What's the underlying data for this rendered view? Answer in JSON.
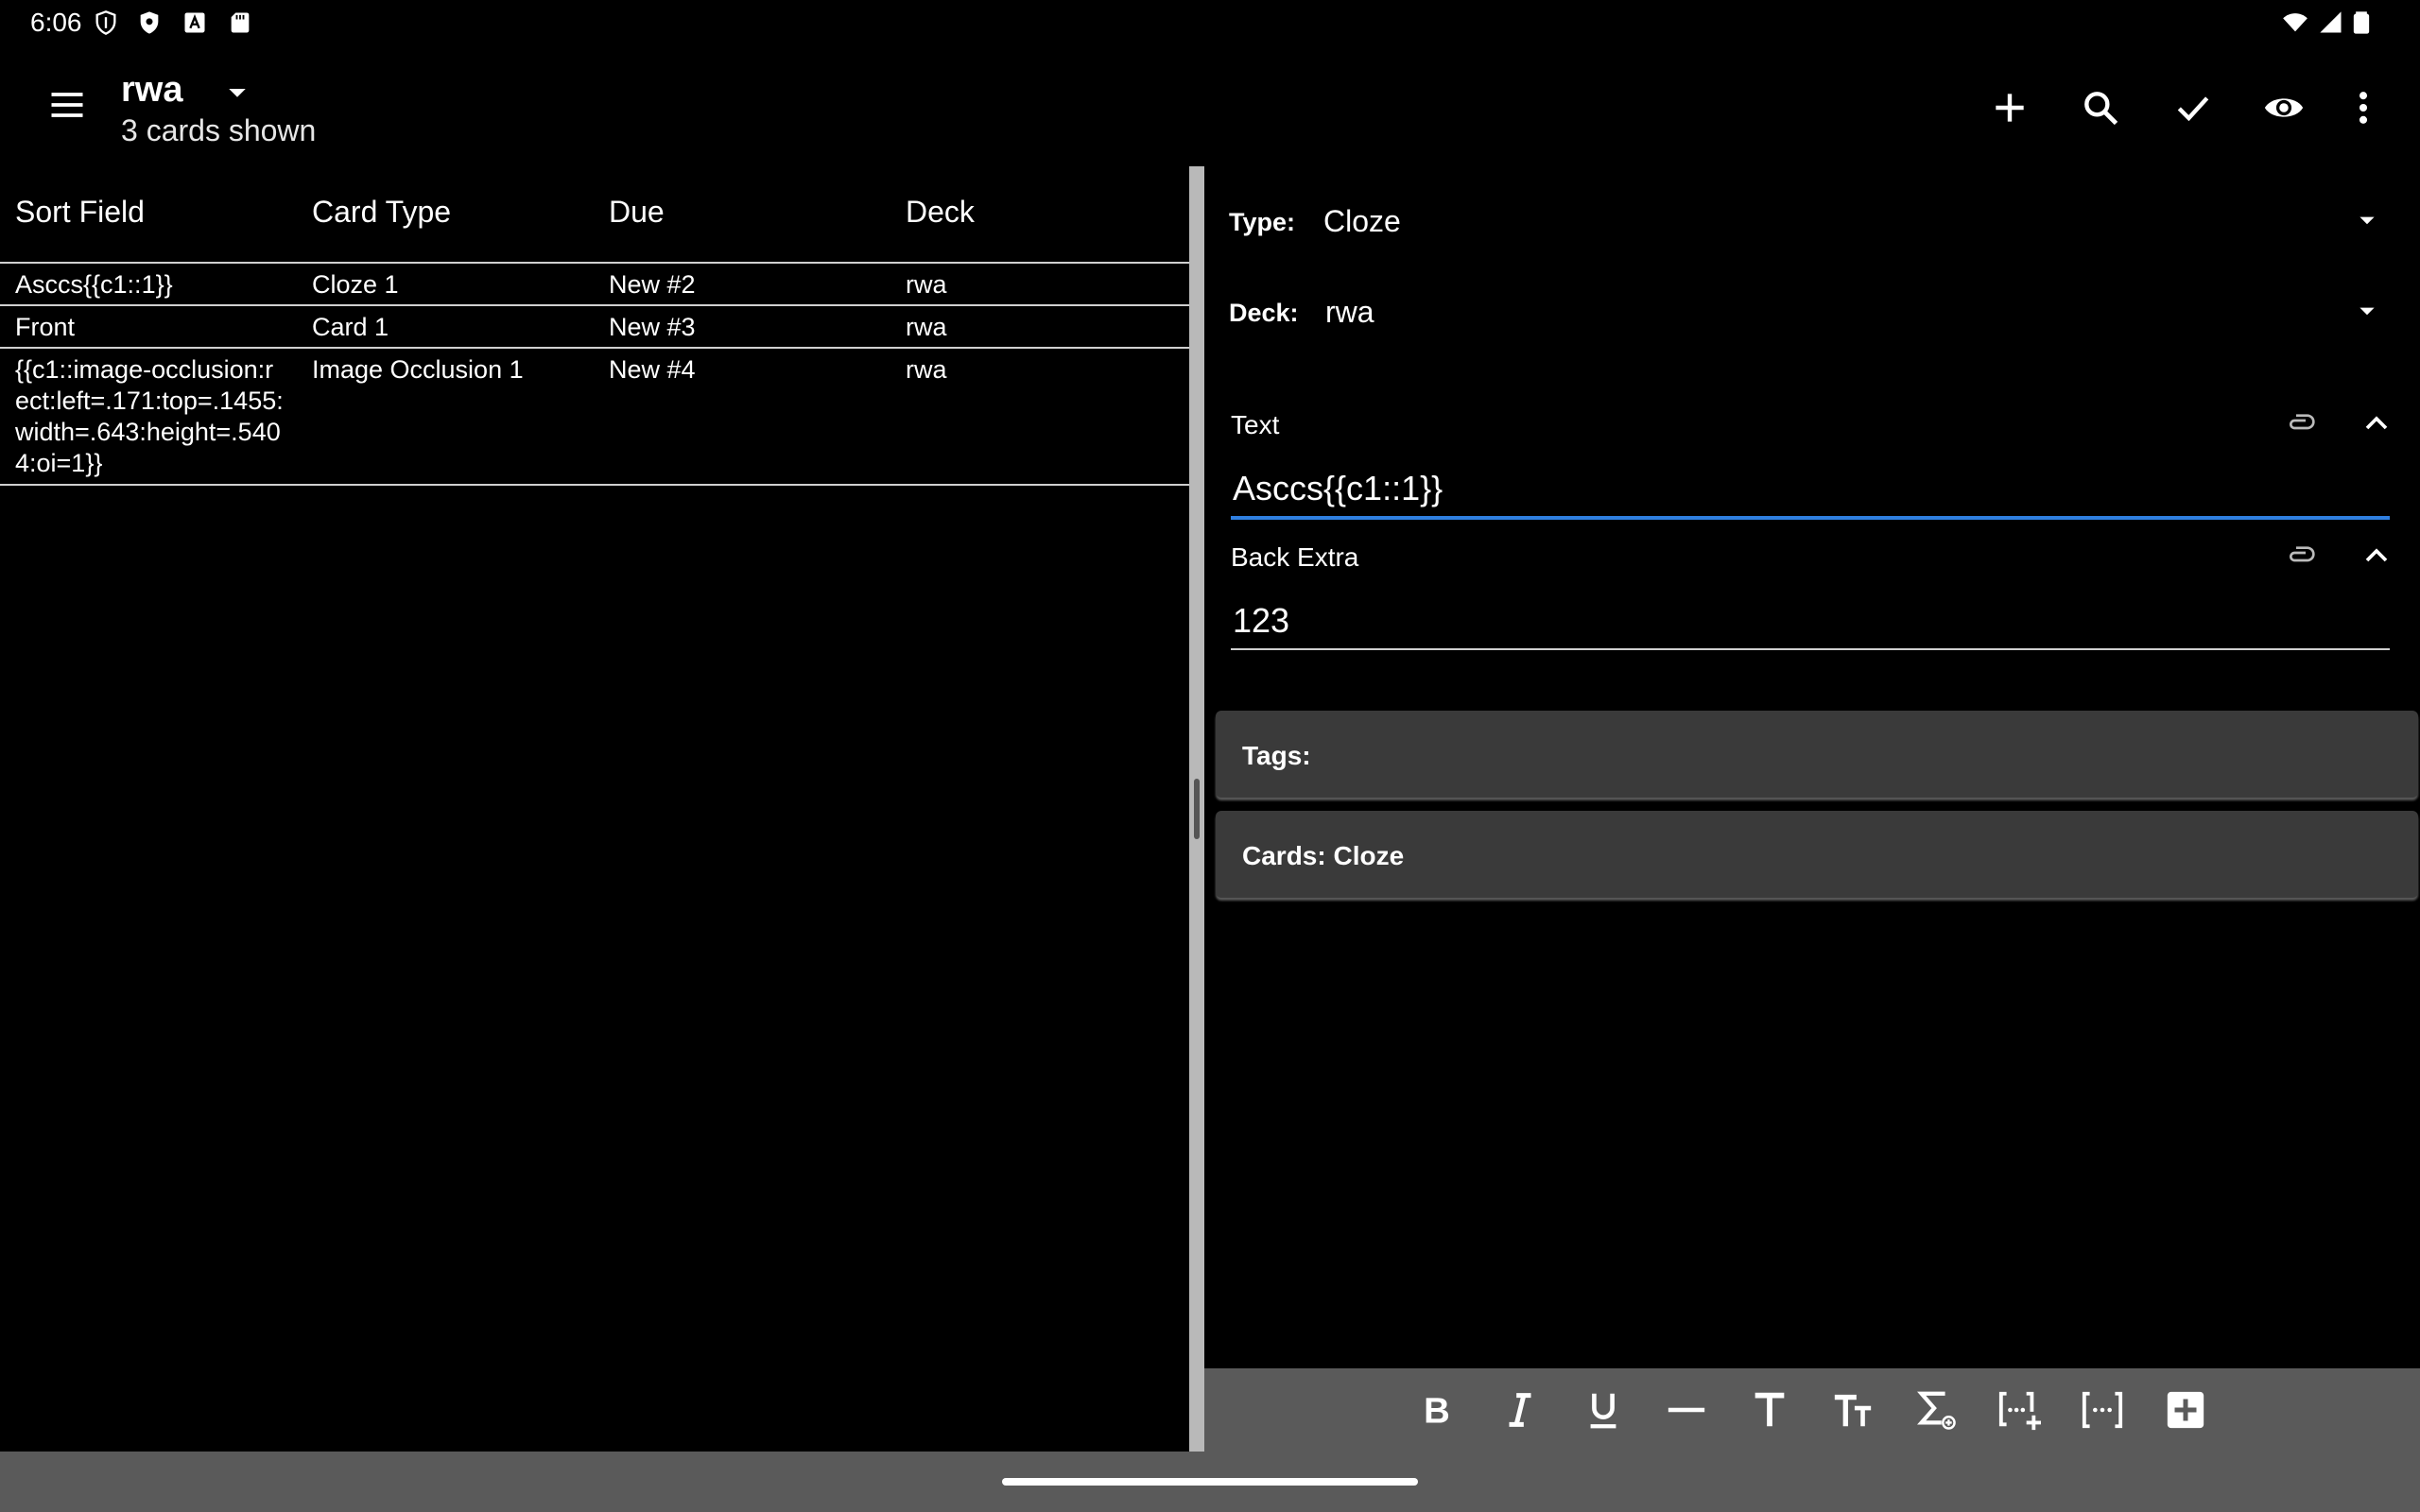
{
  "status_bar": {
    "time": "6:06",
    "left_icons": [
      "shield-outline-icon",
      "shield-filled-icon",
      "font-a-icon",
      "sd-card-icon"
    ],
    "right_icons": [
      "wifi-icon",
      "cellular-signal-icon",
      "battery-icon"
    ]
  },
  "app_bar": {
    "title": "rwa",
    "subtitle": "3 cards shown",
    "actions": [
      "add-icon",
      "search-icon",
      "check-icon",
      "eye-icon",
      "more-vert-icon"
    ]
  },
  "browser": {
    "columns": [
      "Sort Field",
      "Card Type",
      "Due",
      "Deck"
    ],
    "rows": [
      {
        "sort_field": "Asccs{{c1::1}}",
        "card_type": "Cloze 1",
        "due": "New #2",
        "deck": "rwa"
      },
      {
        "sort_field": "Front",
        "card_type": "Card 1",
        "due": "New #3",
        "deck": "rwa"
      },
      {
        "sort_field_lines": [
          "{{c1::image-occlusion:r",
          "ect:left=.171:top=.1455:",
          "width=.643:height=.540",
          "4:oi=1}}"
        ],
        "card_type": "Image Occlusion 1",
        "due": "New #4",
        "deck": "rwa"
      }
    ]
  },
  "editor": {
    "type_label": "Type:",
    "type_value": "Cloze",
    "deck_label": "Deck:",
    "deck_value": "rwa",
    "fields": [
      {
        "name": "Text",
        "value": "Asccs{{c1::1}}"
      },
      {
        "name": "Back Extra",
        "value": "123"
      }
    ],
    "tags_label": "Tags:",
    "cards_label": "Cards: Cloze"
  },
  "toolbar": {
    "buttons": [
      "bold",
      "italic",
      "underline",
      "horizontal-rule",
      "font-size",
      "text-case",
      "mathjax",
      "cloze-new",
      "cloze-same",
      "add-custom"
    ]
  },
  "colors": {
    "background": "#000000",
    "accent": "#2f7fe0",
    "panel": "#3a3a3a",
    "toolbar": "#5a5a5a"
  }
}
